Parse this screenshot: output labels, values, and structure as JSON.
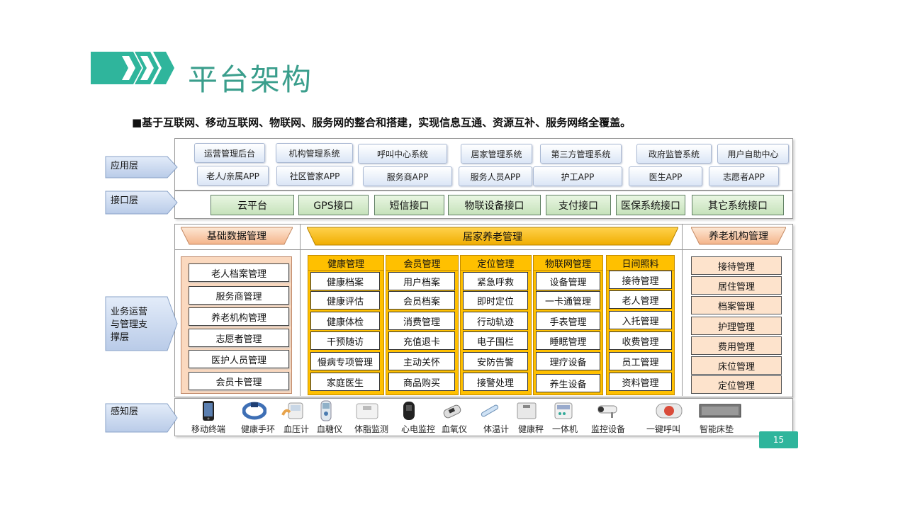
{
  "title": "平台架构",
  "subtitle": "■基于互联网、移动互联网、物联网、服务网的整合和搭建，实现信息互通、资源互补、服务网络全覆盖。",
  "page_number": "15",
  "colors": {
    "accent": "#2fb59c",
    "title": "#3a9e8c",
    "gold": "#ffc000",
    "peach": "#fbd9bf"
  },
  "layers": {
    "application": "应用层",
    "interface": "接口层",
    "business": [
      "业务运营",
      "与管理支",
      "撑层"
    ],
    "perception": "感知层"
  },
  "application_row1": [
    "运营管理后台",
    "机构管理系统",
    "呼叫中心系统",
    "居家管理系统",
    "第三方管理系统",
    "政府监管系统",
    "用户自助中心"
  ],
  "application_row2": [
    "老人/亲属APP",
    "社区管家APP",
    "服务商APP",
    "服务人员APP",
    "护工APP",
    "医生APP",
    "志愿者APP"
  ],
  "interfaces": [
    "云平台",
    "GPS接口",
    "短信接口",
    "物联设备接口",
    "支付接口",
    "医保系统接口",
    "其它系统接口"
  ],
  "basic_data": {
    "header": "基础数据管理",
    "items": [
      "老人档案管理",
      "服务商管理",
      "养老机构管理",
      "志愿者管理",
      "医护人员管理",
      "会员卡管理"
    ]
  },
  "home_care": {
    "header": "居家养老管理",
    "columns": [
      {
        "title": "健康管理",
        "items": [
          "健康档案",
          "健康评估",
          "健康体检",
          "干预随访",
          "慢病专项管理",
          "家庭医生"
        ]
      },
      {
        "title": "会员管理",
        "items": [
          "用户档案",
          "会员档案",
          "消费管理",
          "充值退卡",
          "主动关怀",
          "商品购买"
        ]
      },
      {
        "title": "定位管理",
        "items": [
          "紧急呼救",
          "即时定位",
          "行动轨迹",
          "电子围栏",
          "安防告警",
          "接警处理"
        ]
      },
      {
        "title": "物联网管理",
        "items": [
          "设备管理",
          "一卡通管理",
          "手表管理",
          "睡眠管理",
          "理疗设备",
          "养生设备"
        ]
      },
      {
        "title": "日间照料",
        "items": [
          "接待管理",
          "老人管理",
          "入托管理",
          "收费管理",
          "员工管理",
          "资料管理"
        ]
      }
    ]
  },
  "institution": {
    "header": "养老机构管理",
    "items": [
      "接待管理",
      "居住管理",
      "档案管理",
      "护理管理",
      "费用管理",
      "床位管理",
      "定位管理"
    ]
  },
  "devices": [
    {
      "label": "移动终端",
      "icon": "phone-icon"
    },
    {
      "label": "健康手环",
      "icon": "wristband-icon"
    },
    {
      "label": "血压计",
      "icon": "blood-pressure-icon"
    },
    {
      "label": "血糖仪",
      "icon": "glucose-meter-icon"
    },
    {
      "label": "体脂监测",
      "icon": "body-fat-scale-icon"
    },
    {
      "label": "心电监控",
      "icon": "ecg-monitor-icon"
    },
    {
      "label": "血氧仪",
      "icon": "oximeter-icon"
    },
    {
      "label": "体温计",
      "icon": "thermometer-icon"
    },
    {
      "label": "健康秤",
      "icon": "scale-icon"
    },
    {
      "label": "一体机",
      "icon": "all-in-one-icon"
    },
    {
      "label": "监控设备",
      "icon": "camera-icon"
    },
    {
      "label": "一键呼叫",
      "icon": "sos-button-icon"
    },
    {
      "label": "智能床垫",
      "icon": "mattress-icon"
    }
  ]
}
